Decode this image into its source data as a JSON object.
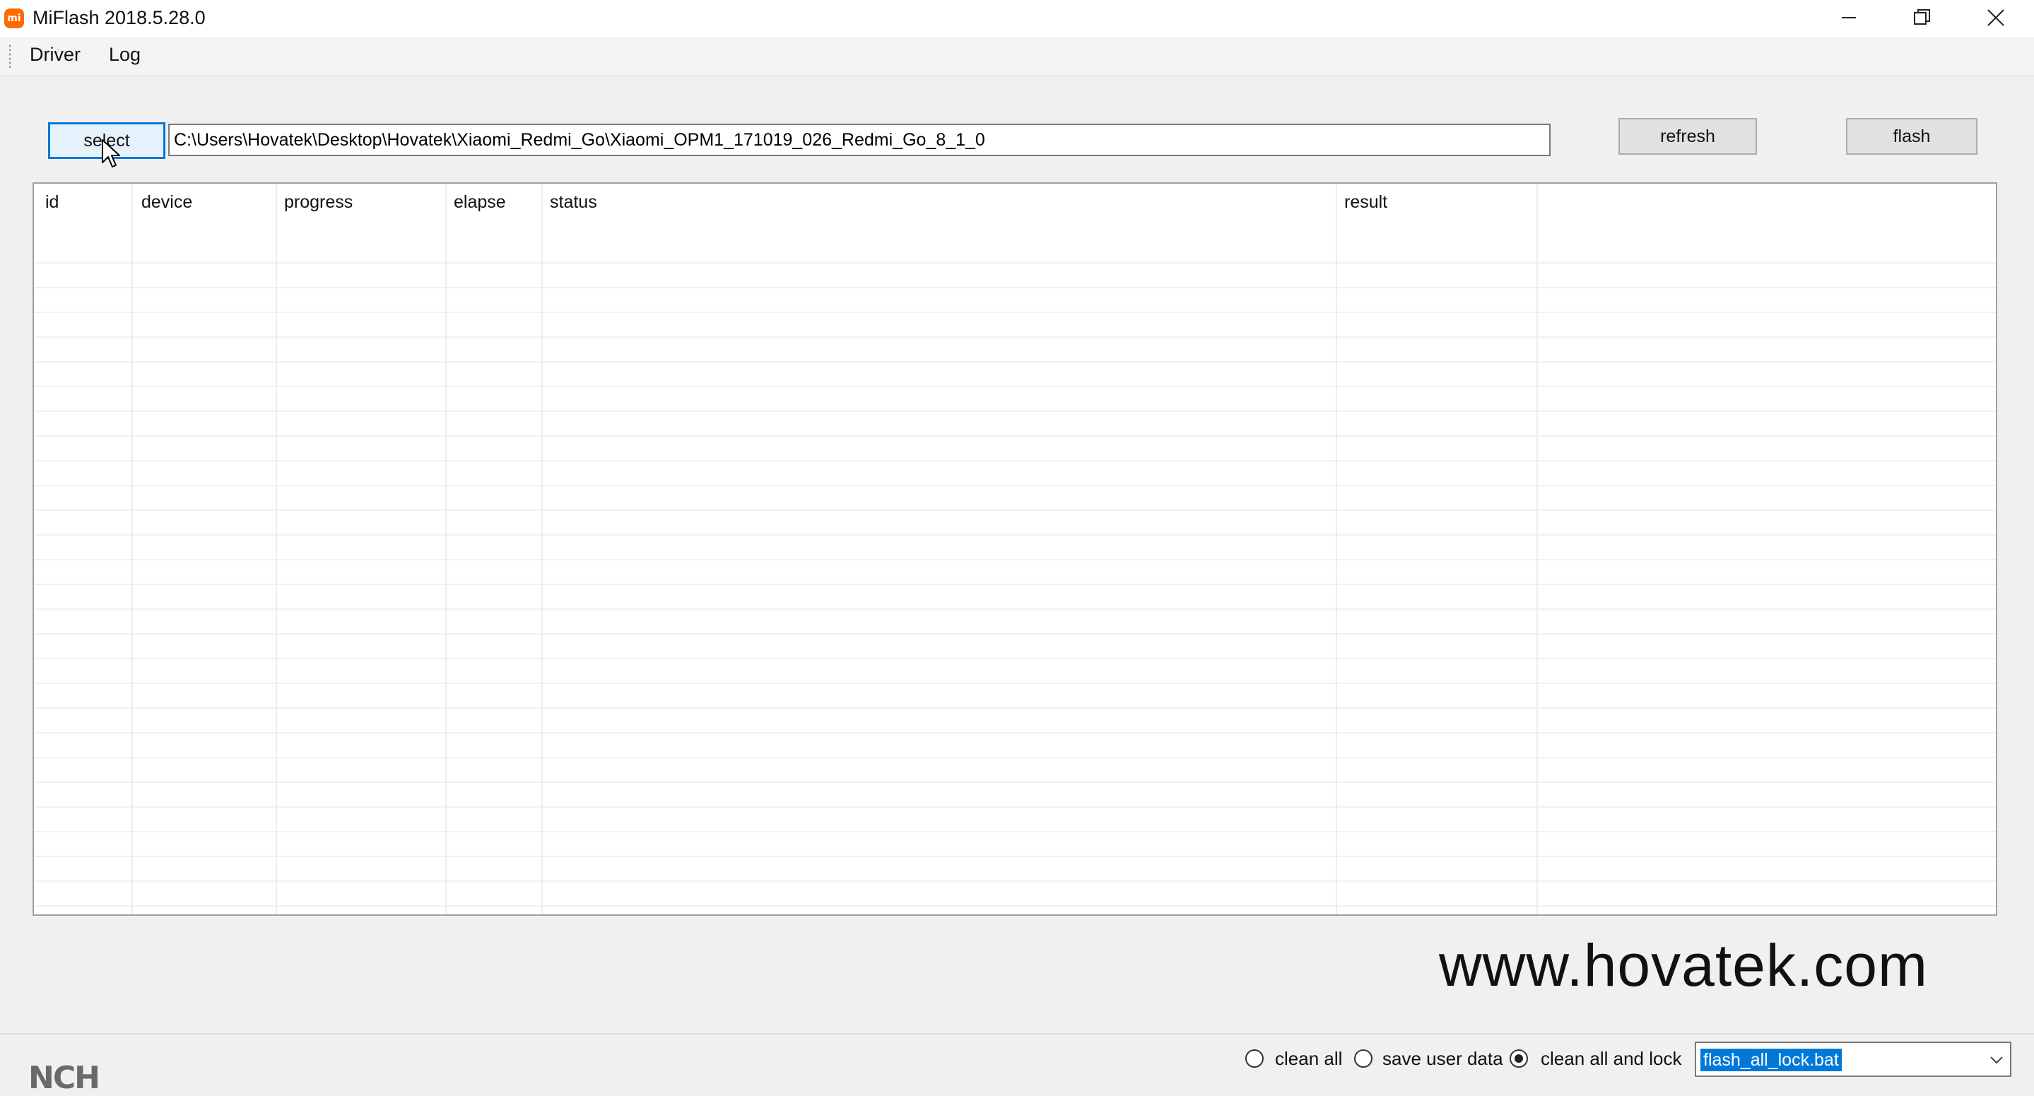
{
  "window": {
    "title": "MiFlash 2018.5.28.0",
    "app_icon": "mi-logo-icon",
    "controls": [
      "minimize-icon",
      "restore-icon",
      "close-icon"
    ]
  },
  "menu": {
    "items": [
      {
        "label": "Driver"
      },
      {
        "label": "Log"
      }
    ]
  },
  "toolbar": {
    "select_label": "select",
    "path_value": "C:\\Users\\Hovatek\\Desktop\\Hovatek\\Xiaomi_Redmi_Go\\Xiaomi_OPM1_171019_026_Redmi_Go_8_1_0",
    "refresh_label": "refresh",
    "flash_label": "flash"
  },
  "table": {
    "columns": [
      "id",
      "device",
      "progress",
      "elapse",
      "status",
      "result"
    ],
    "rows": []
  },
  "watermark": "www.hovatek.com",
  "options": {
    "radios": [
      {
        "label": "clean all",
        "checked": false
      },
      {
        "label": "save user data",
        "checked": false
      },
      {
        "label": "clean all and lock",
        "checked": true
      }
    ],
    "script_value": "flash_all_lock.bat"
  },
  "colors": {
    "accent": "#0078d7",
    "app_icon": "#ff6a00",
    "window_bg": "#f0f0f0"
  }
}
